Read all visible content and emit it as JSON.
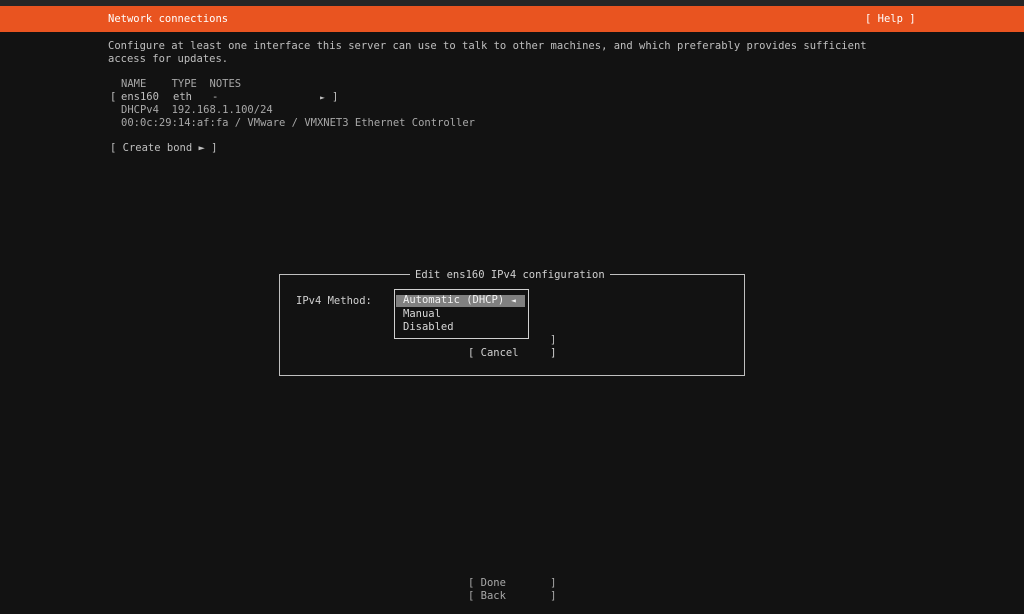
{
  "header": {
    "title": "Network connections",
    "help_label": "[ Help ]"
  },
  "description": {
    "line1": "Configure at least one interface this server can use to talk to other machines, and which preferably provides sufficient",
    "line2": "access for updates."
  },
  "interfaces": {
    "header_row": "NAME    TYPE  NOTES",
    "row_open_bracket": "[",
    "row_name": "ens160",
    "row_type": "eth",
    "row_notes": "-",
    "row_arrow": "►",
    "row_close_bracket": "]",
    "dhcp_line": "DHCPv4  192.168.1.100/24",
    "hw_line": "00:0c:29:14:af:fa / VMware / VMXNET3 Ethernet Controller"
  },
  "create_bond_label": "[ Create bond ► ]",
  "dialog": {
    "title": "Edit ens160 IPv4 configuration",
    "method_label": "IPv4 Method:",
    "options": [
      "Automatic (DHCP)",
      "Manual",
      "Disabled"
    ],
    "selected_option": "Automatic (DHCP)",
    "selected_arrow": "◄",
    "save_fragment": "]",
    "cancel_label": "[ Cancel     ]"
  },
  "footer": {
    "done_label": "[ Done       ]",
    "back_label": "[ Back       ]"
  },
  "colors": {
    "accent": "#e95420",
    "background": "#121212",
    "text": "#bfbfbf"
  }
}
